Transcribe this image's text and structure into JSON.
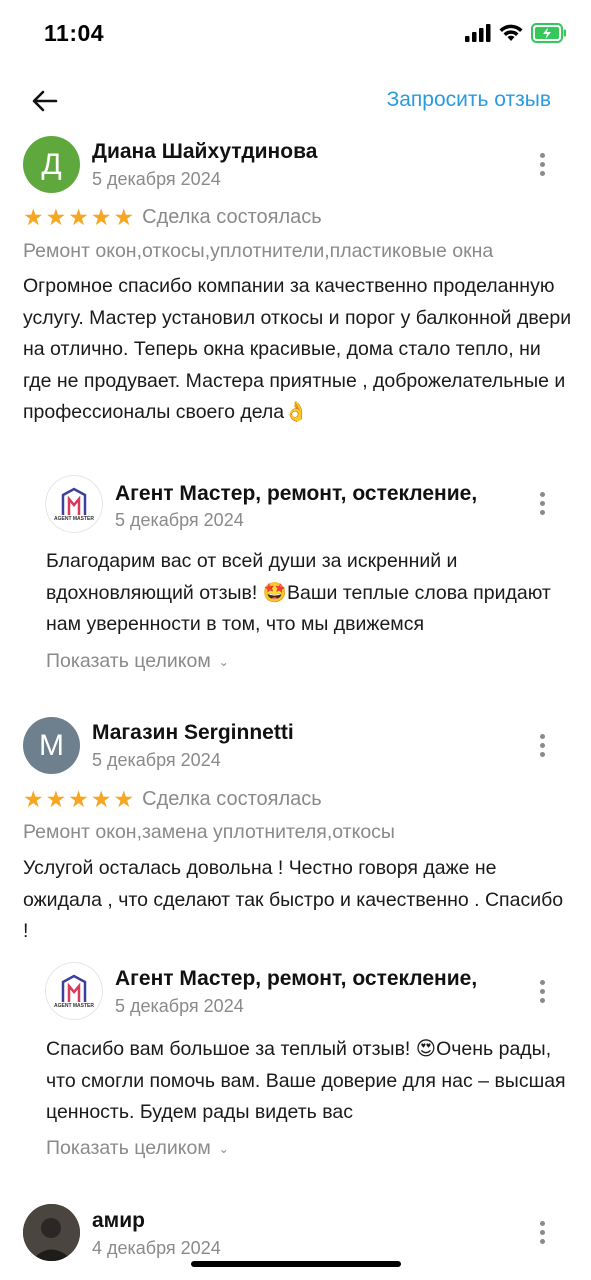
{
  "status": {
    "time": "11:04"
  },
  "header": {
    "request_review": "Запросить отзыв"
  },
  "reviews": [
    {
      "avatar_letter": "Д",
      "avatar_color": "#5fa83e",
      "author": "Диана Шайхутдинова",
      "date": "5 декабря 2024",
      "rating": 5,
      "deal_status": "Сделка состоялась",
      "services": "Ремонт окон,откосы,уплотнители,пластиковые окна",
      "text": "Огромное спасибо компании за качественно проделанную услугу. Мастер установил откосы и порог у балконной двери на отлично. Теперь окна красивые, дома стало тепло, ни где не продувает. Мастера приятные , доброжелательные и профессионалы своего дела👌",
      "reply": {
        "author": "Агент Мастер, ремонт, остекление,",
        "date": "5 декабря 2024",
        "text": "Благодарим вас от всей души за искренний и вдохновляющий отзыв! 🤩Ваши теплые слова придают нам уверенности в том, что мы движемся",
        "show_all": "Показать целиком"
      }
    },
    {
      "avatar_letter": "М",
      "avatar_color": "#6e7f8d",
      "author": "Магазин  Serginnetti",
      "date": "5 декабря 2024",
      "rating": 5,
      "deal_status": "Сделка состоялась",
      "services": "Ремонт окон,замена уплотнителя,откосы",
      "text": "Услугой осталась довольна ! Честно говоря даже не ожидала , что сделают так быстро и качественно . Спасибо !",
      "reply": {
        "author": "Агент Мастер, ремонт, остекление,",
        "date": "5 декабря 2024",
        "text": "Спасибо вам большое за теплый отзыв! 😍Очень рады, что смогли помочь вам. Ваше доверие для нас – высшая ценность. Будем рады видеть вас",
        "show_all": "Показать целиком"
      }
    },
    {
      "avatar_letter": "",
      "author": "амир",
      "date": "4 декабря 2024"
    }
  ],
  "logo": {
    "top_text": "AGENT MASTER",
    "accent_colors": [
      "#d93a5a",
      "#3b3f9e"
    ]
  }
}
